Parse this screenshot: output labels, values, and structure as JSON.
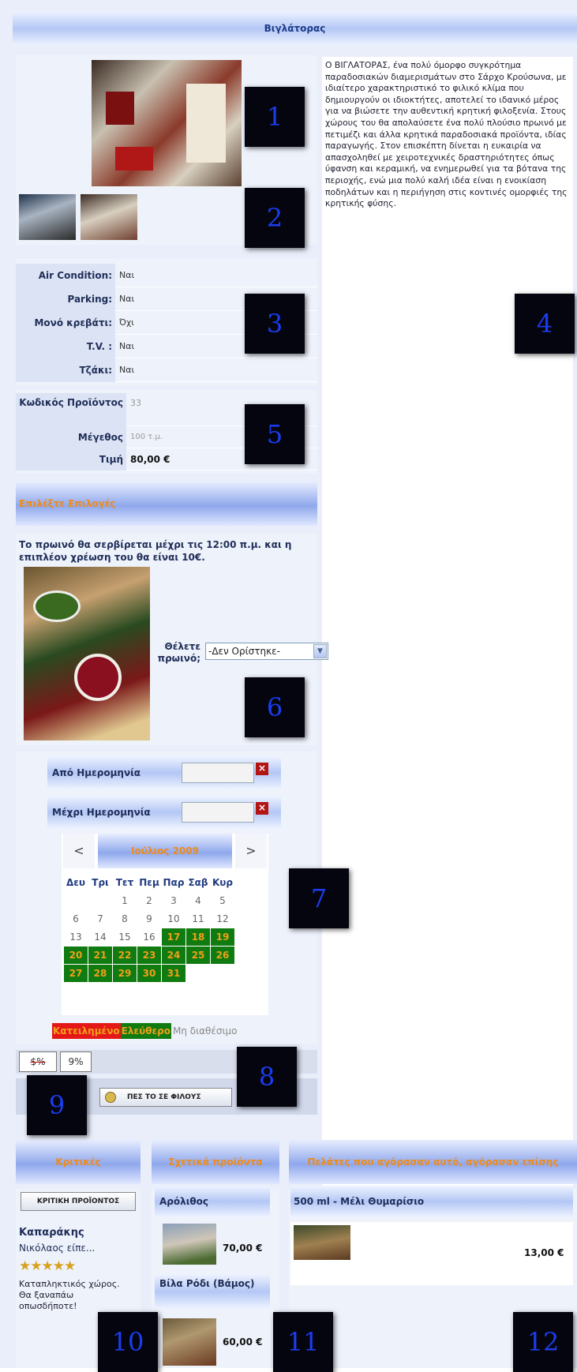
{
  "page_title": "Βιγλάτορας",
  "badges": [
    "1",
    "2",
    "3",
    "4",
    "5",
    "6",
    "7",
    "8",
    "9",
    "10",
    "11",
    "12"
  ],
  "description": "Ο ΒΙΓΛΑΤΟΡΑΣ, ένα πολύ όμορφο συγκρότημα παραδοσιακών διαμερισμάτων στο Σάρχο Κρούσωνα, με ιδιαίτερο χαρακτηριστικό το φιλικό κλίμα που δημιουργούν οι ιδιοκτήτες, αποτελεί το ιδανικό μέρος για να βιώσετε την αυθεντική κρητική φιλοξενία. Στους χώρους του θα απολαύσετε ένα πολύ πλούσιο πρωινό με πετιμέζι και άλλα κρητικά παραδοσιακά προϊόντα, ιδίας παραγωγής. Στον επισκέπτη δίνεται η ευκαιρία να απασχοληθεί με χειροτεχνικές δραστηριότητες όπως ύφανση και κεραμική, να ενημερωθεί για τα βότανα της περιοχής, ενώ μια πολύ καλή ιδέα είναι η ενοικίαση ποδηλάτων και η περιήγηση στις κοντινές ομορφιές της κρητικής φύσης.",
  "features": [
    {
      "label": "Air Condition:",
      "value": "Ναι"
    },
    {
      "label": "Parking:",
      "value": "Ναι"
    },
    {
      "label": "Μονό κρεβάτι:",
      "value": "Όχι"
    },
    {
      "label": "T.V. :",
      "value": "Ναι"
    },
    {
      "label": "Τζάκι:",
      "value": "Ναι"
    }
  ],
  "product": {
    "code_label": "Κωδικός Προϊόντος",
    "code": "33",
    "size_label": "Μέγεθος",
    "size": "100 τ.μ.",
    "price_label": "Τιμή",
    "price": "80,00 €"
  },
  "extras": {
    "title": "Επιλέξτε Επιλογές",
    "note": "Το πρωινό θα σερβίρεται μέχρι τις 12:00 π.μ. και η επιπλέον χρέωση του θα είναι 10€.",
    "breakfast_label": "Θέλετε πρωινό;",
    "breakfast_selected": "-Δεν Ορίστηκε-"
  },
  "dates": {
    "from_label": "Από Ημερομηνία",
    "to_label": "Μέχρι Ημερομηνία",
    "prev": "<",
    "next": ">",
    "month": "Ιούλιος 2009",
    "weekdays": [
      "Δευ",
      "Τρι",
      "Τετ",
      "Πεμ",
      "Παρ",
      "Σαβ",
      "Κυρ"
    ],
    "legend_booked": "Κατειλημένο",
    "legend_free": "Ελεύθερο",
    "legend_na": "Μη διαθέσιμο"
  },
  "tell_friends": "ΠΕΣ ΤΟ ΣΕ ΦΙΛΟΥΣ",
  "reviews": {
    "title": "Κριτικές",
    "button": "ΚΡΙΤΙΚΗ ΠΡΟΪΟΝΤΟΣ",
    "author": "Καπαράκης",
    "author2": "Νικόλαος είπε...",
    "rating": 5,
    "text": "Καταπληκτικός χώρος. Θα ξαναπάω οπωσδήποτε!"
  },
  "related": {
    "title": "Σχετικά προϊόντα",
    "items": [
      {
        "name": "Αρόλιθος",
        "price": "70,00 €"
      },
      {
        "name": "Βίλα Ρόδι (Βάμος)",
        "price": "60,00 €"
      }
    ]
  },
  "also_bought": {
    "title": "Πελάτες που αγόρασαν αυτό, αγόρασαν επίσης",
    "item_name": "500 ml - Μέλι Θυμαρίσιο",
    "item_price": "13,00 €"
  }
}
